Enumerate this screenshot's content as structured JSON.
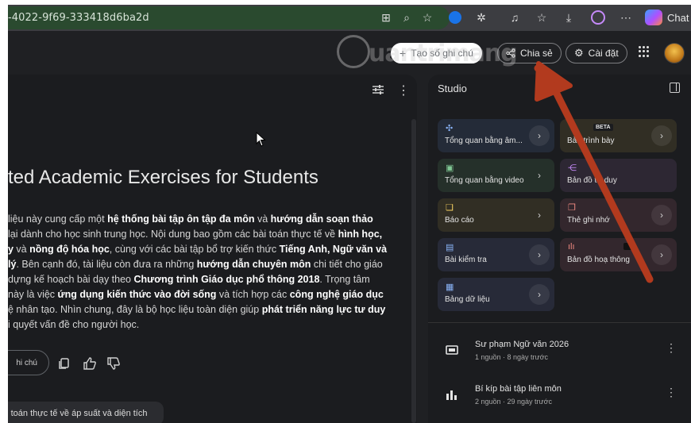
{
  "browser": {
    "url": "-4022-9f69-333418d6ba2d",
    "chat_label": "Chat"
  },
  "header": {
    "create_note_label": "Tạo số ghi chú",
    "share_label": "Chia sẻ",
    "settings_label": "Cài đặt"
  },
  "watermark": {
    "text": "uantrimang"
  },
  "chat": {
    "doc_title": "ted Academic Exercises for Students",
    "save_note_label": "hi chú",
    "suggestion": "ài toán thực tế về áp suất và diện tích"
  },
  "studio": {
    "title": "Studio",
    "badge": "BETA",
    "tiles": [
      {
        "label": "Tổng quan bằng âm...",
        "icon": "waveform-icon"
      },
      {
        "label": "Bản trình bày",
        "icon": "slides-icon"
      },
      {
        "label": "Tổng quan bằng video",
        "icon": "video-icon"
      },
      {
        "label": "Bản đồ tư duy",
        "icon": "mindmap-icon"
      },
      {
        "label": "Báo cáo",
        "icon": "report-icon"
      },
      {
        "label": "Thẻ ghi nhớ",
        "icon": "flashcards-icon"
      },
      {
        "label": "Bài kiểm tra",
        "icon": "quiz-icon"
      },
      {
        "label": "Bản đồ hoạ thông",
        "icon": "infographic-icon"
      },
      {
        "label": "Bảng dữ liệu",
        "icon": "table-icon"
      }
    ],
    "notes": [
      {
        "title": "Sư phạm Ngữ văn 2026",
        "meta": "1 nguồn · 8 ngày trước"
      },
      {
        "title": "Bí kíp bài tập liên môn",
        "meta": "2 nguồn · 29 ngày trước"
      }
    ]
  }
}
